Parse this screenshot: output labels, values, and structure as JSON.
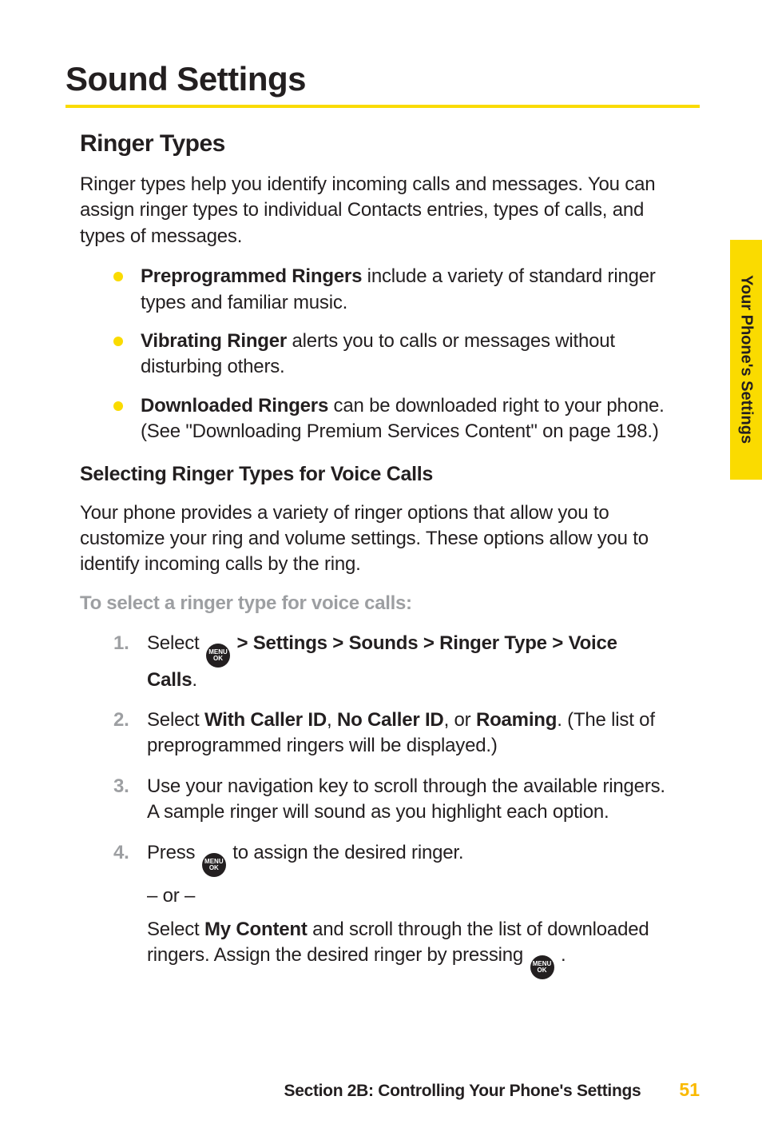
{
  "sideTab": "Your Phone's Settings",
  "title": "Sound Settings",
  "subtitle": "Ringer Types",
  "intro": "Ringer types help you identify incoming calls and messages. You can assign ringer types to individual Contacts entries, types of calls, and types of messages.",
  "bullets": [
    {
      "bold": "Preprogrammed Ringers",
      "rest": " include a variety of standard ringer types and familiar music."
    },
    {
      "bold": "Vibrating Ringer",
      "rest": " alerts you to calls or messages without disturbing others."
    },
    {
      "bold": "Downloaded Ringers",
      "rest": " can be downloaded right to your phone. (See \"Downloading Premium Services Content\" on page 198.)"
    }
  ],
  "h3": "Selecting Ringer Types for Voice Calls",
  "para2": "Your phone provides a variety of ringer options that allow you to customize your ring and volume settings. These options allow you to identify incoming calls by the ring.",
  "lead": "To select a ringer type for voice calls:",
  "menuIcon": {
    "line1": "MENU",
    "line2": "OK"
  },
  "steps": {
    "s1_a": "Select ",
    "s1_b": " > Settings > Sounds > Ringer Type > Voice Calls",
    "s1_c": ".",
    "s2_a": "Select ",
    "s2_b": "With Caller ID",
    "s2_c": ", ",
    "s2_d": "No Caller ID",
    "s2_e": ", or ",
    "s2_f": "Roaming",
    "s2_g": ". (The list of preprogrammed ringers will be displayed.)",
    "s3": "Use your navigation key to scroll through the available ringers. A sample ringer will sound as you highlight each option.",
    "s4_a": "Press ",
    "s4_b": " to assign the desired ringer.",
    "or": "– or –",
    "s4_c": "Select ",
    "s4_d": "My Content",
    "s4_e": " and scroll through the list of downloaded ringers. Assign the desired ringer by pressing ",
    "s4_f": " ."
  },
  "footer": {
    "section": "Section 2B: Controlling Your Phone's Settings",
    "page": "51"
  }
}
